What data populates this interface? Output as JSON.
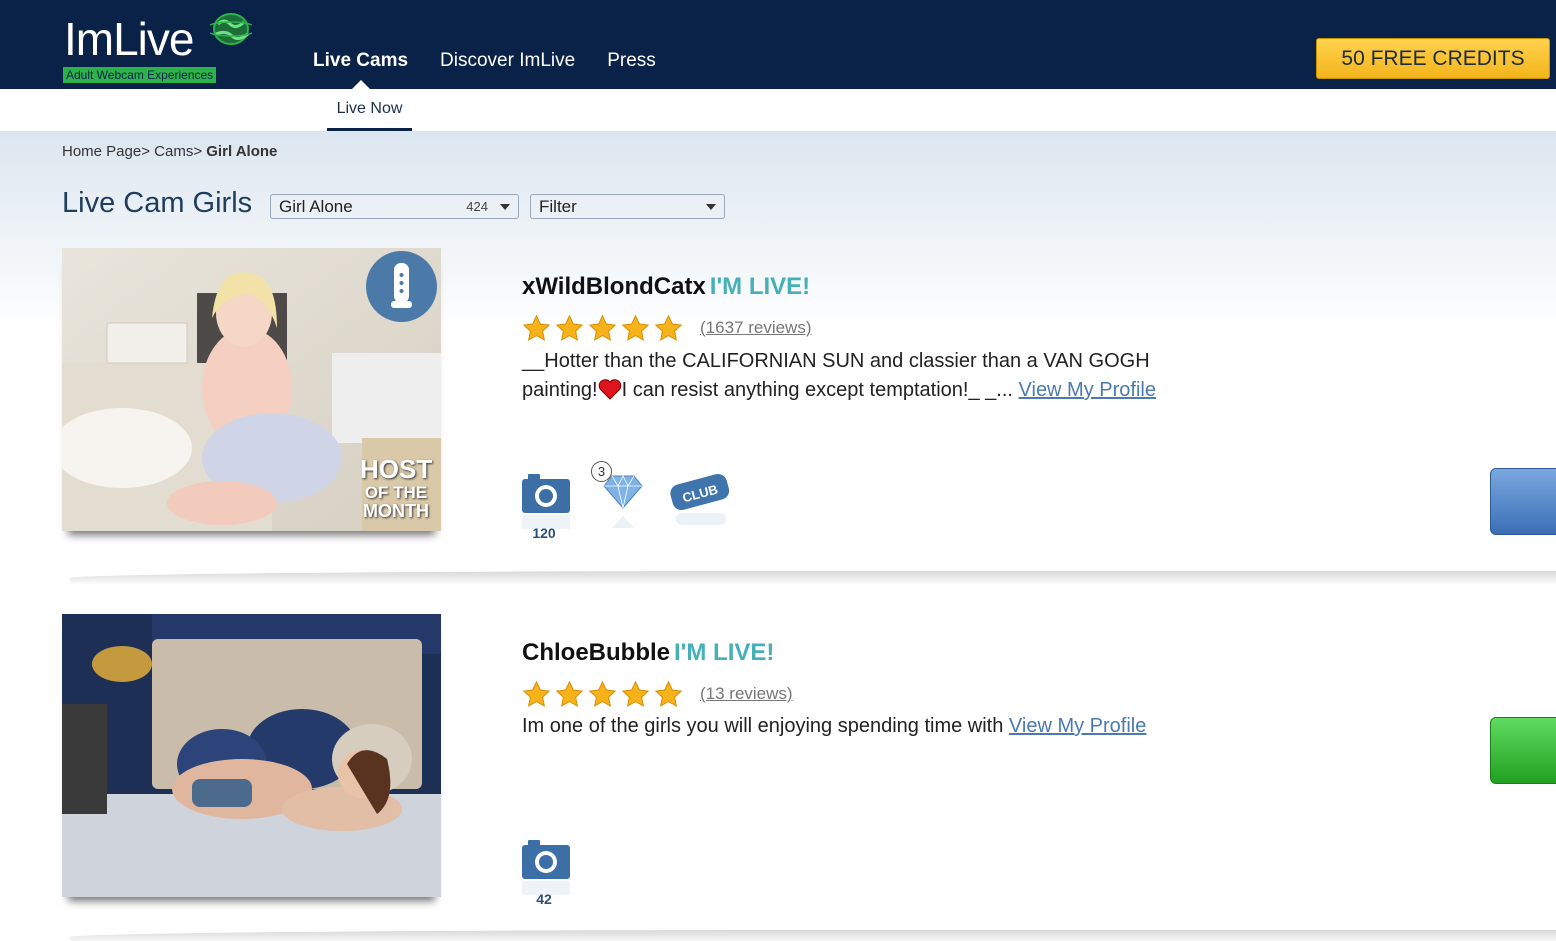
{
  "header": {
    "logo_text": "ImLive",
    "logo_tagline": "Adult Webcam Experiences",
    "nav": [
      {
        "label": "Live Cams"
      },
      {
        "label": "Discover ImLive"
      },
      {
        "label": "Press"
      }
    ],
    "credits_button": "50 FREE CREDITS",
    "subnav_label": "Live Now"
  },
  "breadcrumb": {
    "home": "Home Page>",
    "cams": "Cams>",
    "current": "Girl Alone"
  },
  "listing": {
    "title": "Live Cam Girls",
    "category_select": {
      "value": "Girl Alone",
      "count": "424"
    },
    "filter_select": {
      "value": "Filter"
    }
  },
  "models": [
    {
      "name": "xWildBlondCatx",
      "status": "I'M LIVE!",
      "reviews": "(1637 reviews)",
      "description_part1": "__Hotter than the CALIFORNIAN SUN and classier than a VAN GOGH painting!",
      "description_part2": "I can resist anything except temptation!_ _...",
      "profile_link": "View My Profile",
      "photo_count": "120",
      "diamond_level": "3",
      "badge": "HOST OF THE MONTH",
      "rating": 5
    },
    {
      "name": "ChloeBubble",
      "status": "I'M LIVE!",
      "reviews": "(13 reviews)",
      "description_part1": "Im one of the girls you will enjoying spending time with",
      "profile_link": "View My Profile",
      "photo_count": "42",
      "rating": 5
    }
  ],
  "icons": [
    "globe-icon",
    "toy-icon",
    "star-icon",
    "heart-icon",
    "camera-icon",
    "diamond-icon",
    "club-icon"
  ],
  "colors": {
    "header_bg": "#0b2248",
    "credits_button": "#f7c331",
    "live_label": "#46b0b8",
    "link": "#4a7aaf",
    "side_blue": "#3b6fb6",
    "side_green": "#22a022"
  }
}
